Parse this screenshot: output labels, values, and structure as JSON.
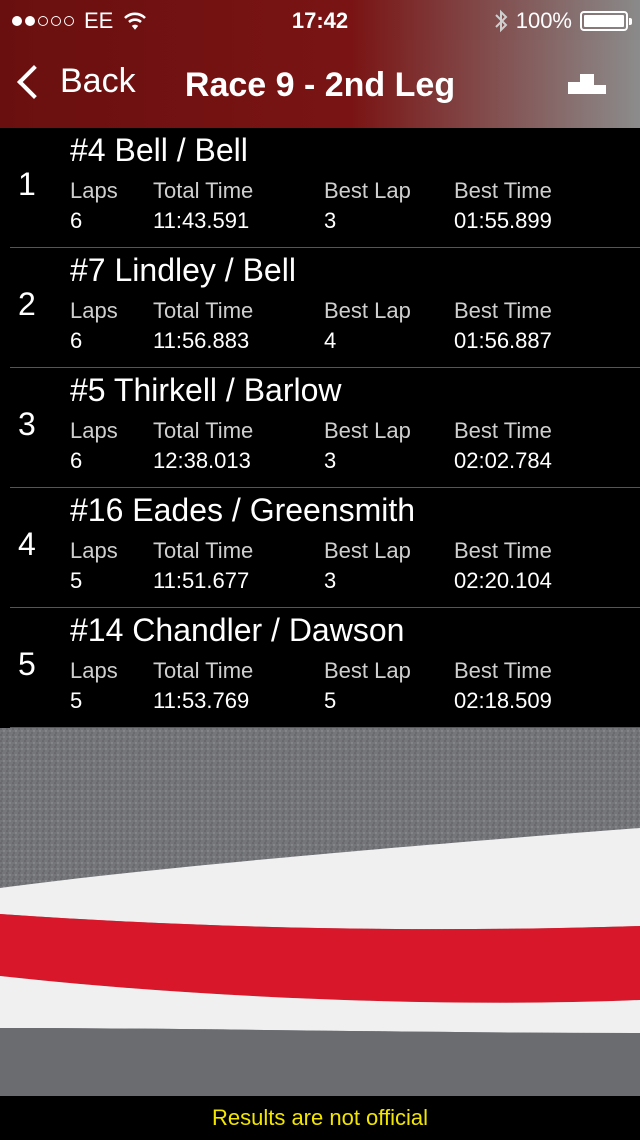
{
  "status": {
    "carrier": "EE",
    "time": "17:42",
    "battery": "100%",
    "battery_level": 1.0
  },
  "nav": {
    "back_label": "Back",
    "title": "Race 9 - 2nd Leg",
    "podium_icon": "podium-icon"
  },
  "results": [
    {
      "position": "1",
      "name": "#4 Bell / Bell",
      "laps_label": "Laps",
      "total_label": "Total Time",
      "bestlap_label": "Best Lap",
      "besttime_label": "Best Time",
      "laps": "6",
      "total": "11:43.591",
      "best_lap": "3",
      "best_time": "01:55.899"
    },
    {
      "position": "2",
      "name": "#7 Lindley / Bell",
      "laps_label": "Laps",
      "total_label": "Total Time",
      "bestlap_label": "Best Lap",
      "besttime_label": "Best Time",
      "laps": "6",
      "total": "11:56.883",
      "best_lap": "4",
      "best_time": "01:56.887"
    },
    {
      "position": "3",
      "name": "#5 Thirkell / Barlow",
      "laps_label": "Laps",
      "total_label": "Total Time",
      "bestlap_label": "Best Lap",
      "besttime_label": "Best Time",
      "laps": "6",
      "total": "12:38.013",
      "best_lap": "3",
      "best_time": "02:02.784"
    },
    {
      "position": "4",
      "name": "#16 Eades / Greensmith",
      "laps_label": "Laps",
      "total_label": "Total Time",
      "bestlap_label": "Best Lap",
      "besttime_label": "Best Time",
      "laps": "5",
      "total": "11:51.677",
      "best_lap": "3",
      "best_time": "02:20.104"
    },
    {
      "position": "5",
      "name": "#14 Chandler / Dawson",
      "laps_label": "Laps",
      "total_label": "Total Time",
      "bestlap_label": "Best Lap",
      "besttime_label": "Best Time",
      "laps": "5",
      "total": "11:53.769",
      "best_lap": "5",
      "best_time": "02:18.509"
    }
  ],
  "footer": {
    "notice": "Results are not official"
  },
  "colors": {
    "nav_red": "#7a1414",
    "notice_yellow": "#f2e500",
    "kerb_red": "#d8182a",
    "kerb_white": "#f2f2f2"
  }
}
